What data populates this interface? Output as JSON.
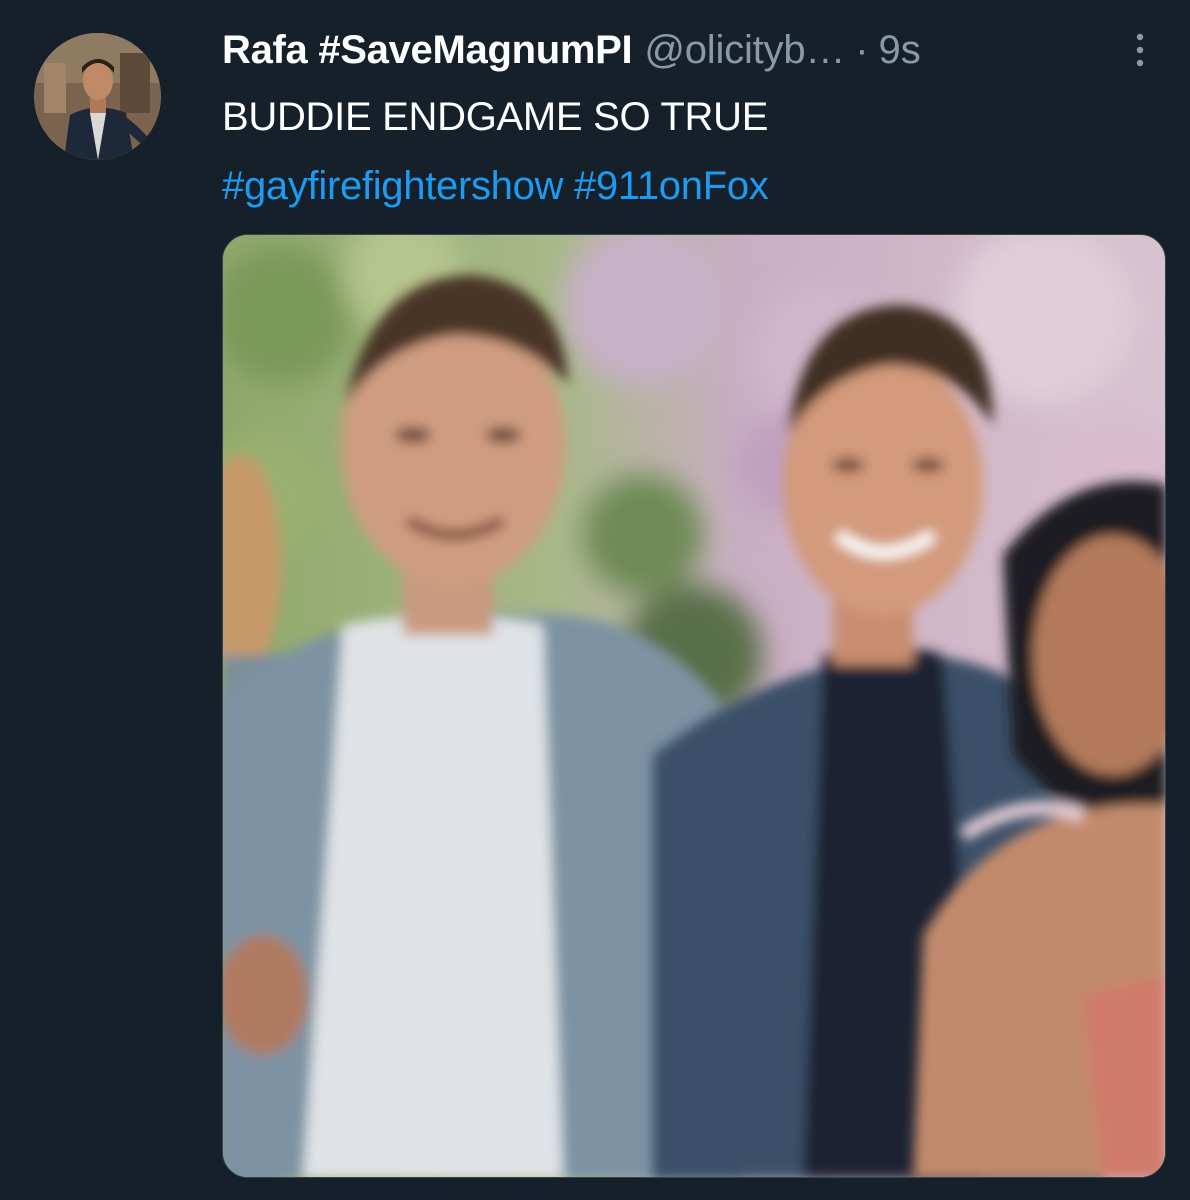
{
  "tweet": {
    "author": {
      "display_name": "Rafa #SaveMagnumPI",
      "handle": "@olicityb…",
      "avatar_icon": "profile-photo"
    },
    "separator": "·",
    "timestamp": "9s",
    "more_icon": "vertical-ellipsis-icon",
    "text": "BUDDIE ENDGAME SO TRUE",
    "hashtags": [
      "#gayfirefightershow",
      "#911onFox"
    ],
    "media": {
      "type": "photo"
    }
  },
  "colors": {
    "background": "#15202b",
    "text_primary": "#ffffff",
    "text_secondary": "#8b98a5",
    "link": "#1d9bf0"
  }
}
